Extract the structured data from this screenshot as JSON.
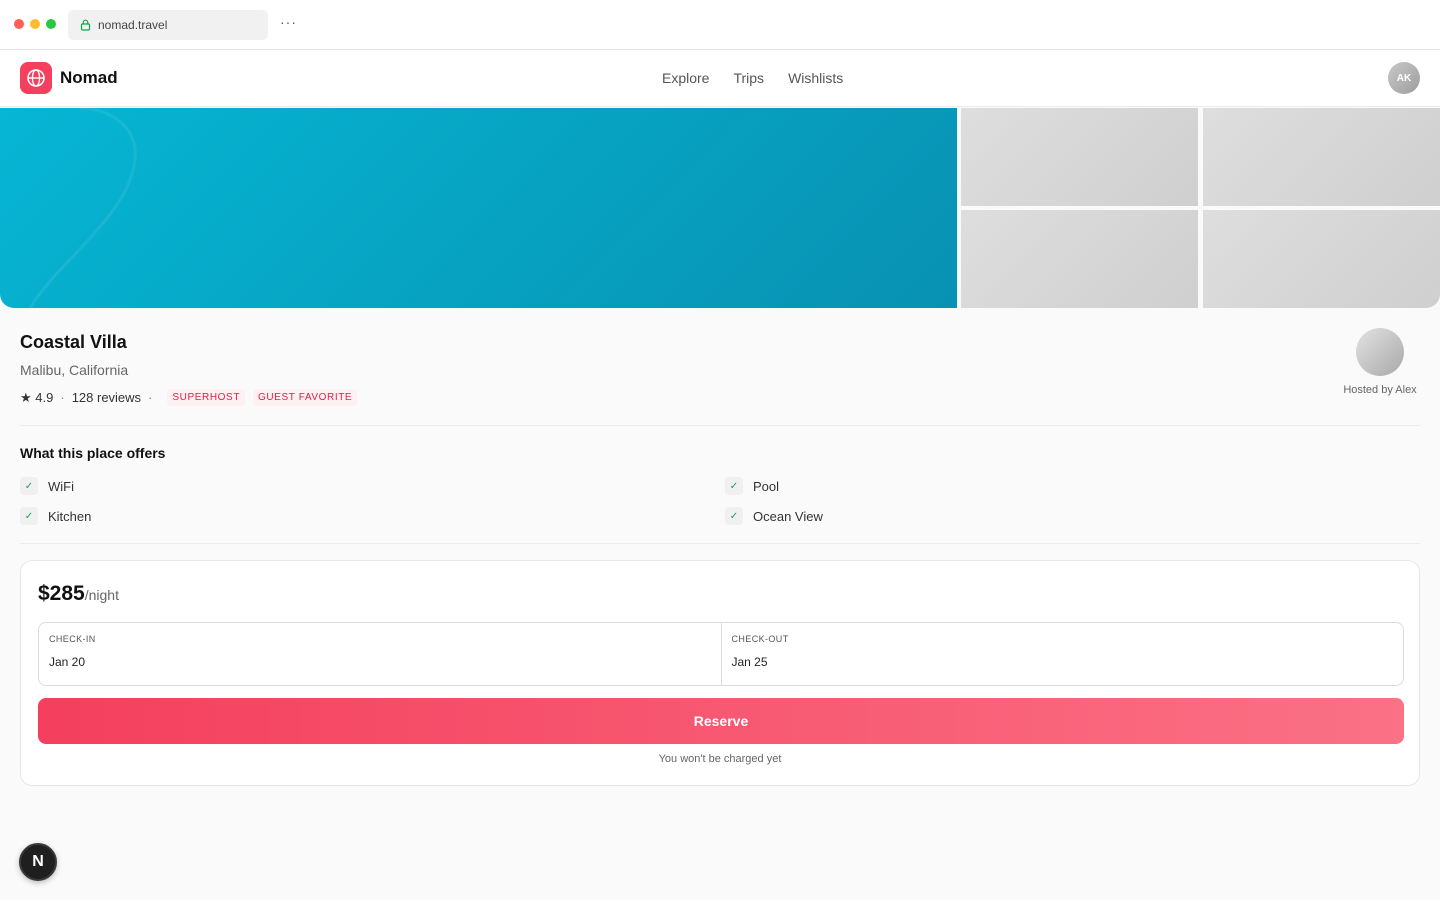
{
  "browser": {
    "url": "nomad.travel",
    "more_label": "···"
  },
  "header": {
    "brand": "Nomad",
    "nav": [
      "Explore",
      "Trips",
      "Wishlists"
    ],
    "avatar_initials": "AK"
  },
  "listing": {
    "title": "Coastal Villa",
    "location": "Malibu, California",
    "rating": "★ 4.9",
    "reviews": "128 reviews",
    "badges": [
      "SUPERHOST",
      "GUEST FAVORITE"
    ],
    "host_label": "Hosted by Alex"
  },
  "amenities": {
    "title": "What this place offers",
    "items": [
      "WiFi",
      "Pool",
      "Kitchen",
      "Ocean View"
    ],
    "check_glyph": "✓"
  },
  "booking": {
    "price": "$285",
    "price_unit": "/night",
    "checkin_label": "CHECK-IN",
    "checkin_value": "Jan 20",
    "checkout_label": "CHECK-OUT",
    "checkout_value": "Jan 25",
    "reserve_label": "Reserve",
    "note": "You won't be charged yet"
  },
  "fab": {
    "label": "N"
  },
  "colors": {
    "accent": "#f43f5e",
    "hero": "#06b6d4"
  }
}
